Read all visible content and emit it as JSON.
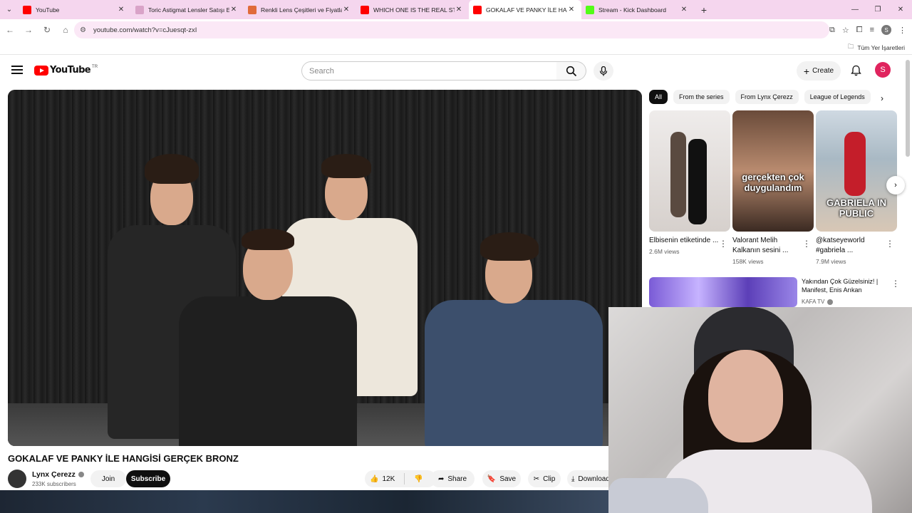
{
  "browser": {
    "tabs": [
      {
        "title": "YouTube",
        "favicon": "youtube-favicon",
        "color": "#ff0000"
      },
      {
        "title": "Toric Astigmat Lensler Satışı En",
        "favicon": "lens-favicon",
        "color": "#d9a3c8"
      },
      {
        "title": "Renkli Lens Çeşitleri ve Fiyatları",
        "favicon": "lens-favicon",
        "color": "#e06b3a"
      },
      {
        "title": "WHICH ONE IS THE REAL STAN",
        "favicon": "youtube-favicon",
        "color": "#ff0000"
      },
      {
        "title": "GOKALAF VE PANKY İLE HANGİ",
        "favicon": "youtube-favicon",
        "color": "#ff0000"
      },
      {
        "title": "Stream - Kick Dashboard",
        "favicon": "kick-favicon",
        "color": "#53fc18"
      }
    ],
    "active_tab": 4,
    "url": "youtube.com/watch?v=cJuesqt-zxI",
    "bookmarks_label": "Tüm Yer İşaretleri",
    "profile_initial": "S"
  },
  "youtube": {
    "country_code": "TR",
    "logo_text": "YouTube",
    "search_placeholder": "Search",
    "create_label": "Create",
    "avatar_initial": "S"
  },
  "video": {
    "title": "GOKALAF VE PANKY İLE HANGİSİ GERÇEK BRONZ",
    "channel": "Lynx Çerezz",
    "subscribers": "233K subscribers",
    "join_label": "Join",
    "subscribe_label": "Subscribe",
    "likes": "12K",
    "share_label": "Share",
    "save_label": "Save",
    "clip_label": "Clip",
    "download_label": "Download"
  },
  "sidebar": {
    "chips": [
      "All",
      "From the series",
      "From Lynx Çerezz",
      "League of Legends"
    ],
    "active_chip": 0,
    "shorts": [
      {
        "title": "Elbisenin etiketinde ...",
        "views": "2.6M views",
        "caption": ""
      },
      {
        "title": "Valorant Melih Kalkanın sesini ...",
        "views": "158K views",
        "caption": "gerçekten çok duygulandım"
      },
      {
        "title": "@katseyeworld #gabriela ...",
        "views": "7.9M views",
        "caption": "GABRIELA IN PUBLIC"
      }
    ],
    "recommendation": {
      "title": "Yakından Çok Güzelsiniz! | Manifest, Enis Arıkan",
      "channel": "KAFA TV"
    }
  }
}
